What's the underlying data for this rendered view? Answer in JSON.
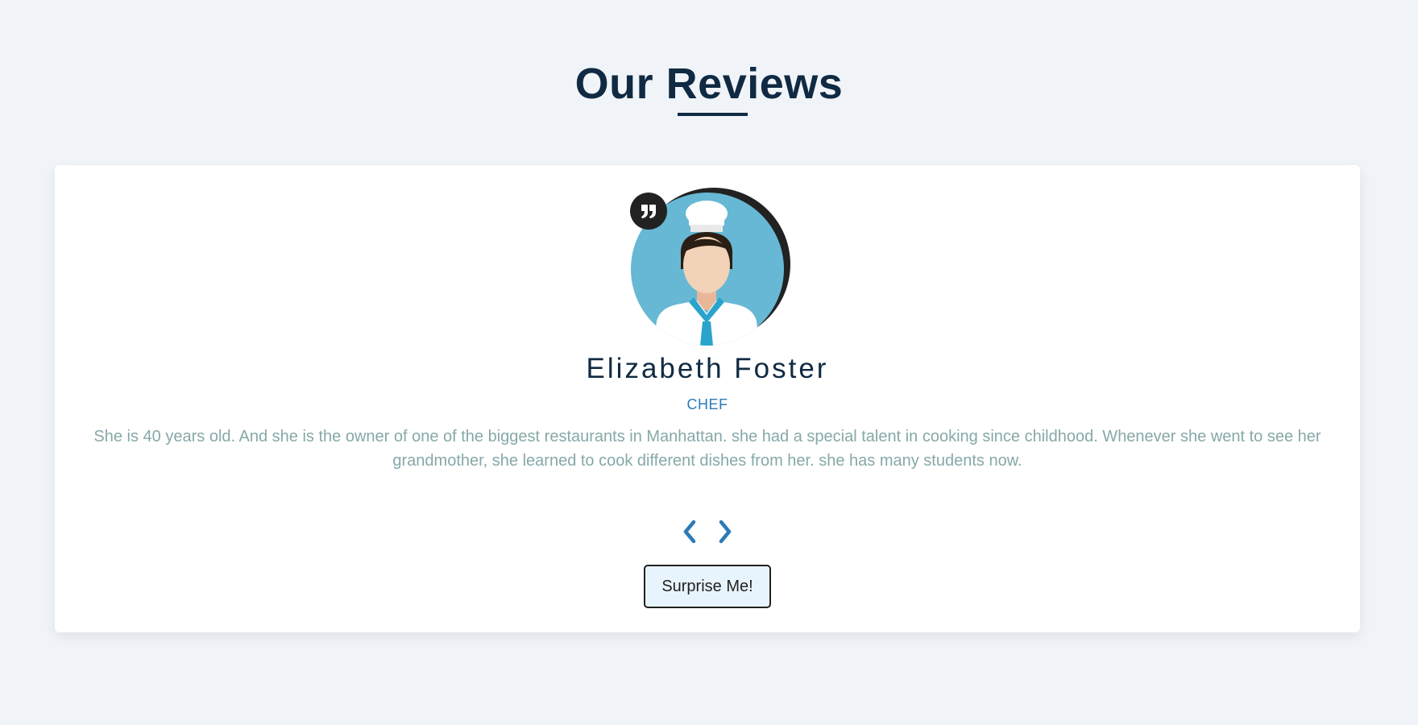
{
  "section": {
    "title": "Our Reviews"
  },
  "review": {
    "author": "Elizabeth Foster",
    "job": "CHEF",
    "text": "She is 40 years old. And she is the owner of one of the biggest restaurants in Manhattan. she had a special talent in cooking since childhood. Whenever she went to see her grandmother, she learned to cook different dishes from her. she has many students now."
  },
  "controls": {
    "prev_icon": "chevron-left-icon",
    "next_icon": "chevron-right-icon",
    "random_label": "Surprise Me!"
  },
  "colors": {
    "background": "#f0f4f8",
    "title": "#102a43",
    "accent": "#2b7bb9",
    "body_text": "#86a8a8",
    "button_bg": "#e8f4fd",
    "avatar_bg": "#66b8d4"
  }
}
